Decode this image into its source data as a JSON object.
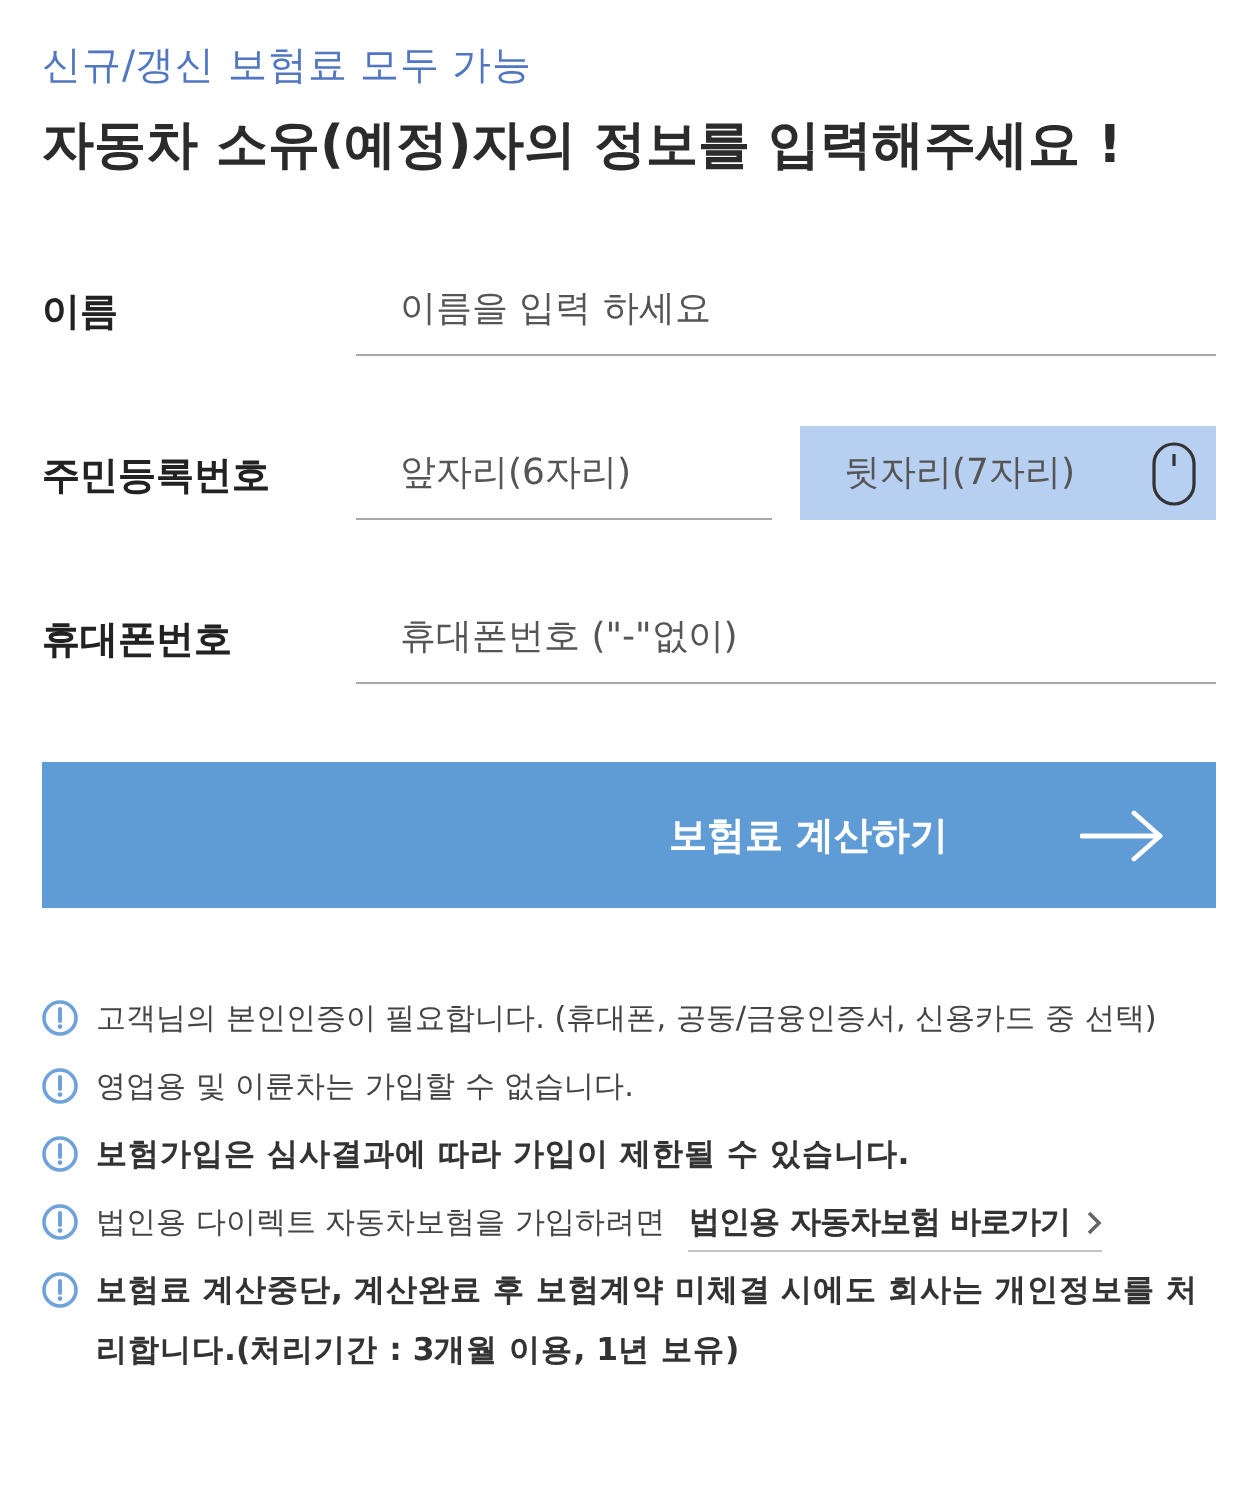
{
  "header": {
    "subtitle": "신규/갱신 보험료 모두 가능",
    "title": "자동차 소유(예정)자의 정보를 입력해주세요 !"
  },
  "form": {
    "rows": [
      {
        "label": "이름",
        "fields": [
          {
            "kind": "text",
            "placeholder": "이름을 입력 하세요",
            "highlighted": false
          }
        ]
      },
      {
        "label": "주민등록번호",
        "fields": [
          {
            "kind": "text",
            "placeholder": "앞자리(6자리)",
            "highlighted": false
          },
          {
            "kind": "secure",
            "placeholder": "뒷자리(7자리)",
            "highlighted": true
          }
        ]
      },
      {
        "label": "휴대폰번호",
        "fields": [
          {
            "kind": "text",
            "placeholder": "휴대폰번호 (\"-\"없이)",
            "highlighted": false
          }
        ]
      }
    ]
  },
  "submit_button": {
    "label": "보험료 계산하기"
  },
  "notices": [
    {
      "text": "고객님의 본인인증이 필요합니다. (휴대폰, 공동/금융인증서, 신용카드 중 선택)",
      "bold": false
    },
    {
      "text": "영업용 및 이륜차는 가입할 수 없습니다.",
      "bold": false
    },
    {
      "text": "보험가입은 심사결과에 따라 가입이 제한될 수 있습니다.",
      "bold": true
    },
    {
      "text": "법인용 다이렉트 자동차보험을 가입하려면",
      "bold": false,
      "link": "법인용 자동차보험 바로가기"
    },
    {
      "text": "보험료 계산중단, 계산완료 후 보험계약 미체결 시에도 회사는 개인정보를 처리합니다.(처리기간 : 3개월 이용, 1년 보유)",
      "bold": true
    }
  ]
}
